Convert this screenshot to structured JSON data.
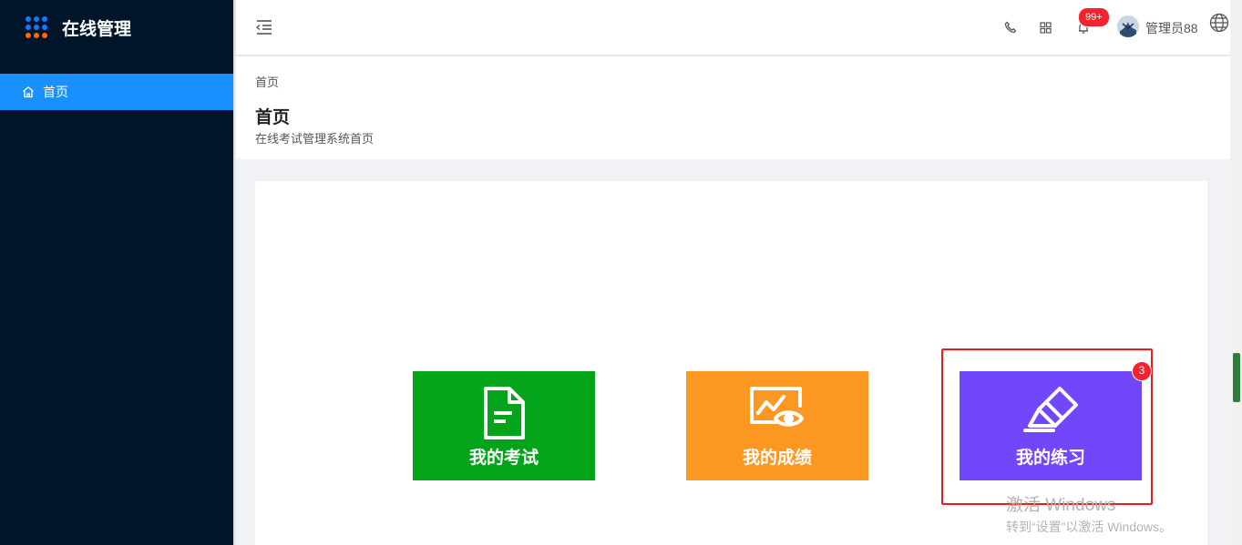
{
  "sidebar": {
    "brand_title": "在线管理",
    "logo_dot_colors": [
      "#1677ff",
      "#1677ff",
      "#1677ff",
      "#1677ff",
      "#1677ff",
      "#1677ff",
      "#ff6a00",
      "#ff6a00",
      "#ff6a00"
    ],
    "items": [
      {
        "label": "首页",
        "icon": "home-icon",
        "active": true
      }
    ]
  },
  "header": {
    "icons": [
      "menu-fold-icon",
      "phone-icon",
      "grid-icon",
      "bell-icon",
      "globe-icon"
    ],
    "notification_badge": "99+",
    "username": "管理员88"
  },
  "page": {
    "breadcrumb": "首页",
    "title": "首页",
    "subtitle": "在线考试管理系统首页"
  },
  "tiles": [
    {
      "label": "我的考试",
      "icon": "document-icon",
      "color": "#03a41a"
    },
    {
      "label": "我的成绩",
      "icon": "chart-eye-icon",
      "color": "#fc9722"
    },
    {
      "label": "我的练习",
      "icon": "highlighter-icon",
      "color": "#7246fb",
      "badge": "3"
    }
  ],
  "watermark": {
    "line1": "激活 Windows",
    "line2": "转到“设置”以激活 Windows。"
  },
  "colors": {
    "sidebar_bg": "#001529",
    "accent": "#1890ff",
    "badge_red": "#f5222d",
    "highlight_red": "#ee1b1b"
  }
}
